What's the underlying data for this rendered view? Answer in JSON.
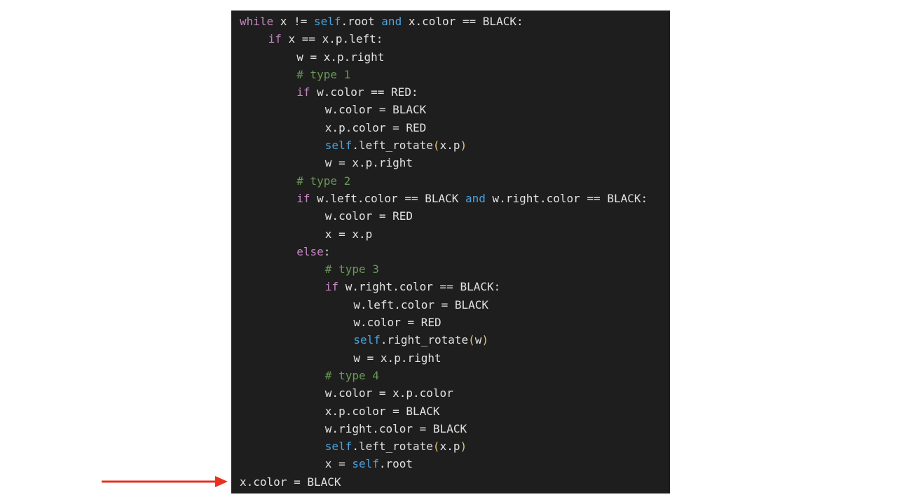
{
  "colors": {
    "page_background": "#ffffff",
    "code_background": "#1e1e1e",
    "plain_text": "#e2e2e2",
    "keyword": "#c586c0",
    "self_and": "#4aa3df",
    "comment": "#6a9955",
    "parenthesis": "#e5c07b",
    "arrow": "#e8321e"
  },
  "pointer": {
    "icon": "arrow-right-icon",
    "target_line": 27
  },
  "code": {
    "lines": [
      {
        "indent": 0,
        "tokens": [
          {
            "t": "while",
            "k": "kw"
          },
          {
            "t": " x != ",
            "k": "plain"
          },
          {
            "t": "self",
            "k": "self"
          },
          {
            "t": ".root ",
            "k": "plain"
          },
          {
            "t": "and",
            "k": "and"
          },
          {
            "t": " x.color == BLACK:",
            "k": "plain"
          }
        ]
      },
      {
        "indent": 1,
        "tokens": [
          {
            "t": "if",
            "k": "kw"
          },
          {
            "t": " x == x.p.left:",
            "k": "plain"
          }
        ]
      },
      {
        "indent": 2,
        "tokens": [
          {
            "t": "w = x.p.right",
            "k": "plain"
          }
        ]
      },
      {
        "indent": 2,
        "tokens": [
          {
            "t": "# type 1",
            "k": "comment"
          }
        ]
      },
      {
        "indent": 2,
        "tokens": [
          {
            "t": "if",
            "k": "kw"
          },
          {
            "t": " w.color == RED:",
            "k": "plain"
          }
        ]
      },
      {
        "indent": 3,
        "tokens": [
          {
            "t": "w.color = BLACK",
            "k": "plain"
          }
        ]
      },
      {
        "indent": 3,
        "tokens": [
          {
            "t": "x.p.color = RED",
            "k": "plain"
          }
        ]
      },
      {
        "indent": 3,
        "tokens": [
          {
            "t": "self",
            "k": "self"
          },
          {
            "t": ".left_rotate",
            "k": "plain"
          },
          {
            "t": "(",
            "k": "paren"
          },
          {
            "t": "x.p",
            "k": "plain"
          },
          {
            "t": ")",
            "k": "paren"
          }
        ]
      },
      {
        "indent": 3,
        "tokens": [
          {
            "t": "w = x.p.right",
            "k": "plain"
          }
        ]
      },
      {
        "indent": 2,
        "tokens": [
          {
            "t": "# type 2",
            "k": "comment"
          }
        ]
      },
      {
        "indent": 2,
        "tokens": [
          {
            "t": "if",
            "k": "kw"
          },
          {
            "t": " w.left.color == BLACK ",
            "k": "plain"
          },
          {
            "t": "and",
            "k": "and"
          },
          {
            "t": " w.right.color == BLACK:",
            "k": "plain"
          }
        ]
      },
      {
        "indent": 3,
        "tokens": [
          {
            "t": "w.color = RED",
            "k": "plain"
          }
        ]
      },
      {
        "indent": 3,
        "tokens": [
          {
            "t": "x = x.p",
            "k": "plain"
          }
        ]
      },
      {
        "indent": 2,
        "tokens": [
          {
            "t": "else",
            "k": "kw"
          },
          {
            "t": ":",
            "k": "plain"
          }
        ]
      },
      {
        "indent": 3,
        "tokens": [
          {
            "t": "# type 3",
            "k": "comment"
          }
        ]
      },
      {
        "indent": 3,
        "tokens": [
          {
            "t": "if",
            "k": "kw"
          },
          {
            "t": " w.right.color == BLACK:",
            "k": "plain"
          }
        ]
      },
      {
        "indent": 4,
        "tokens": [
          {
            "t": "w.left.color = BLACK",
            "k": "plain"
          }
        ]
      },
      {
        "indent": 4,
        "tokens": [
          {
            "t": "w.color = RED",
            "k": "plain"
          }
        ]
      },
      {
        "indent": 4,
        "tokens": [
          {
            "t": "self",
            "k": "self"
          },
          {
            "t": ".right_rotate",
            "k": "plain"
          },
          {
            "t": "(",
            "k": "paren"
          },
          {
            "t": "w",
            "k": "plain"
          },
          {
            "t": ")",
            "k": "paren"
          }
        ]
      },
      {
        "indent": 4,
        "tokens": [
          {
            "t": "w = x.p.right",
            "k": "plain"
          }
        ]
      },
      {
        "indent": 3,
        "tokens": [
          {
            "t": "# type 4",
            "k": "comment"
          }
        ]
      },
      {
        "indent": 3,
        "tokens": [
          {
            "t": "w.color = x.p.color",
            "k": "plain"
          }
        ]
      },
      {
        "indent": 3,
        "tokens": [
          {
            "t": "x.p.color = BLACK",
            "k": "plain"
          }
        ]
      },
      {
        "indent": 3,
        "tokens": [
          {
            "t": "w.right.color = BLACK",
            "k": "plain"
          }
        ]
      },
      {
        "indent": 3,
        "tokens": [
          {
            "t": "self",
            "k": "self"
          },
          {
            "t": ".left_rotate",
            "k": "plain"
          },
          {
            "t": "(",
            "k": "paren"
          },
          {
            "t": "x.p",
            "k": "plain"
          },
          {
            "t": ")",
            "k": "paren"
          }
        ]
      },
      {
        "indent": 3,
        "tokens": [
          {
            "t": "x = ",
            "k": "plain"
          },
          {
            "t": "self",
            "k": "self"
          },
          {
            "t": ".root",
            "k": "plain"
          }
        ]
      },
      {
        "indent": 0,
        "tokens": [
          {
            "t": "x.color = BLACK",
            "k": "plain"
          }
        ]
      }
    ]
  }
}
